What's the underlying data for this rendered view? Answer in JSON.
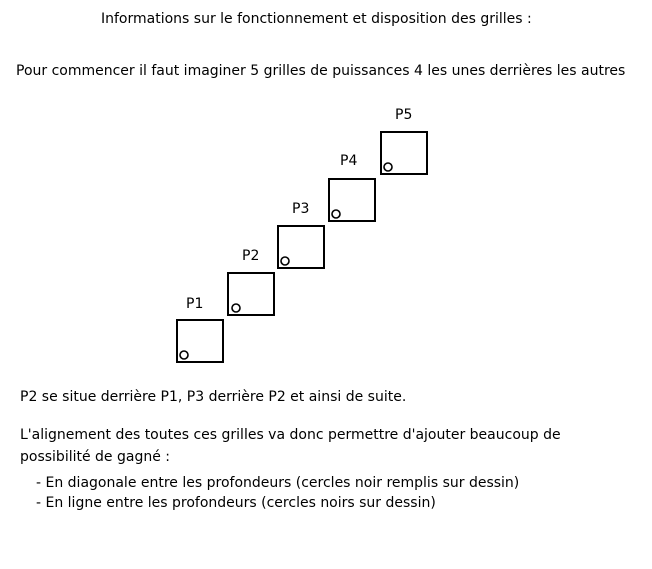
{
  "title": "Informations sur le fonctionnement et disposition des grilles :",
  "intro": "Pour commencer il faut imaginer 5 grilles de puissances 4 les unes derrières les autres",
  "grids": [
    {
      "label": "P1"
    },
    {
      "label": "P2"
    },
    {
      "label": "P3"
    },
    {
      "label": "P4"
    },
    {
      "label": "P5"
    }
  ],
  "note": "P2 se situe derrière P1, P3 derrière P2 et ainsi de suite.",
  "alignment": {
    "line1": "L'alignement des toutes ces grilles va donc permettre d'ajouter beaucoup de",
    "line2": "possibilité de gagné :",
    "bullets": [
      "- En diagonale entre les profondeurs (cercles noir remplis sur dessin)",
      "- En ligne entre les profondeurs (cercles noirs sur dessin)"
    ]
  }
}
